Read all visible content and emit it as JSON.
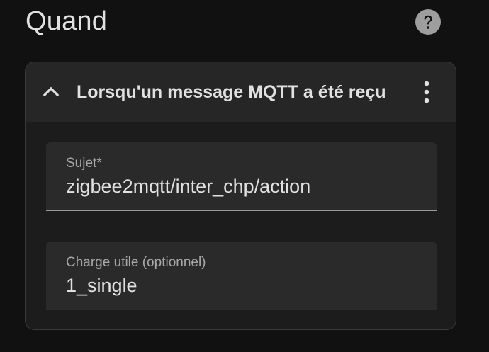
{
  "section": {
    "title": "Quand",
    "help_icon": "help-circle-icon"
  },
  "trigger": {
    "title": "Lorsqu'un message MQTT a été reçu",
    "collapse_icon": "chevron-up-icon",
    "menu_icon": "dots-vertical-icon",
    "fields": [
      {
        "label": "Sujet*",
        "value": "zigbee2mqtt/inter_chp/action"
      },
      {
        "label": "Charge utile (optionnel)",
        "value": "1_single"
      }
    ]
  },
  "colors": {
    "background": "#111111",
    "card": "#1c1c1c",
    "card_header": "#262626",
    "field": "#2a2a2a",
    "text": "#e1e1e1",
    "label": "#a8a8a8",
    "icon": "#9e9e9e"
  }
}
